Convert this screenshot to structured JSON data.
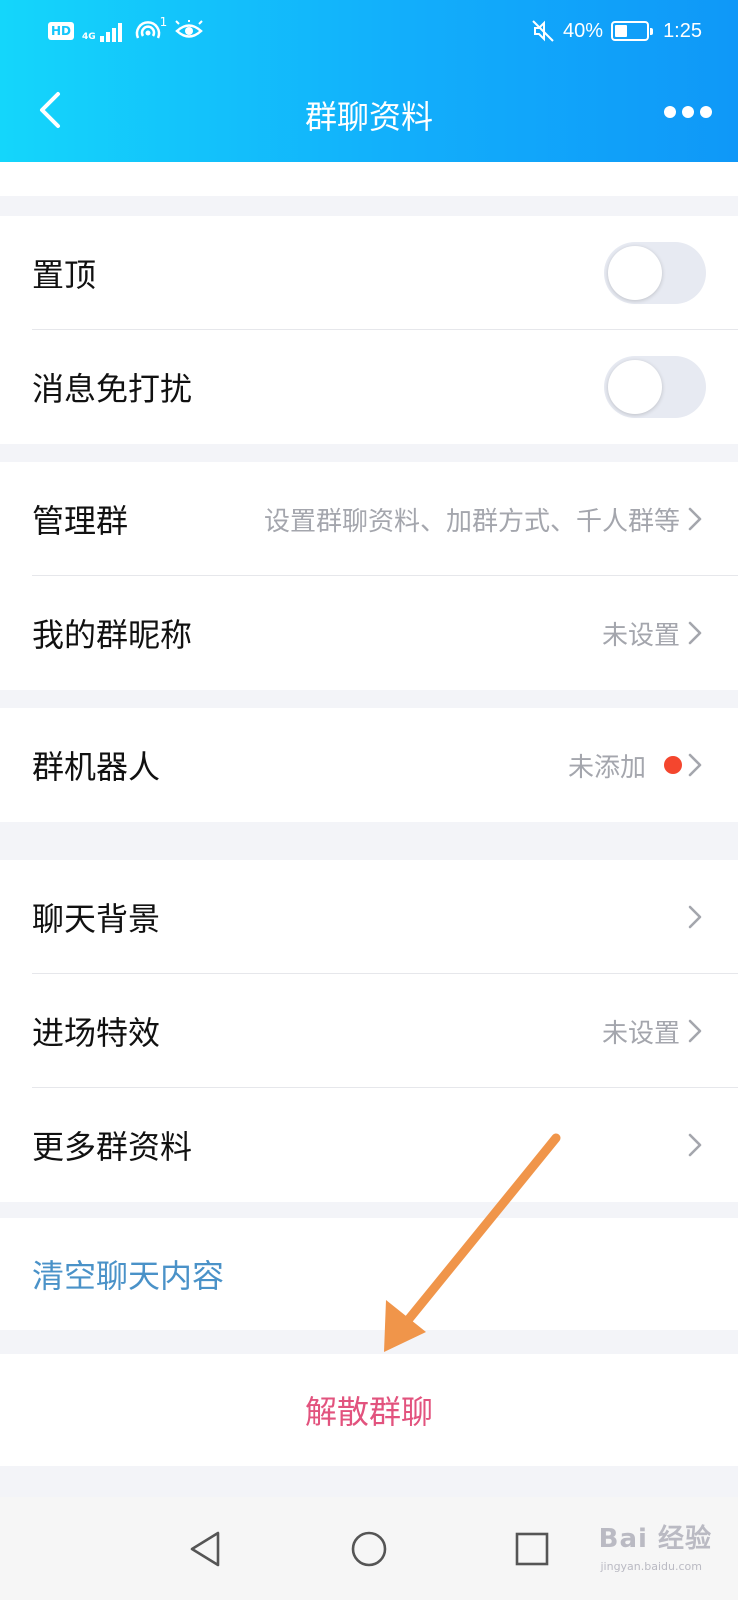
{
  "status_bar": {
    "hd": "HD",
    "network": "4G",
    "hotspot_count": "1",
    "battery_percent": "40%",
    "battery_level": 0.4,
    "time": "1:25"
  },
  "nav": {
    "title": "群聊资料"
  },
  "settings": {
    "pin_top": {
      "label": "置顶",
      "on": false
    },
    "dnd": {
      "label": "消息免打扰",
      "on": false
    },
    "manage_group": {
      "label": "管理群",
      "value": "设置群聊资料、加群方式、千人群等"
    },
    "my_nickname": {
      "label": "我的群昵称",
      "value": "未设置"
    },
    "group_robot": {
      "label": "群机器人",
      "value": "未添加"
    },
    "chat_background": {
      "label": "聊天背景"
    },
    "entry_effect": {
      "label": "进场特效",
      "value": "未设置"
    },
    "more_info": {
      "label": "更多群资料"
    },
    "clear_chat": {
      "label": "清空聊天内容"
    },
    "dissolve": {
      "label": "解散群聊"
    }
  },
  "watermark": {
    "main": "Bai 经验",
    "sub": "jingyan.baidu.com"
  },
  "colors": {
    "header_start": "#14d6fb",
    "header_end": "#0f98f8",
    "link": "#4a92c8",
    "danger": "#e2537e",
    "badge": "#f4462e",
    "annotation_arrow": "#f0954a"
  }
}
